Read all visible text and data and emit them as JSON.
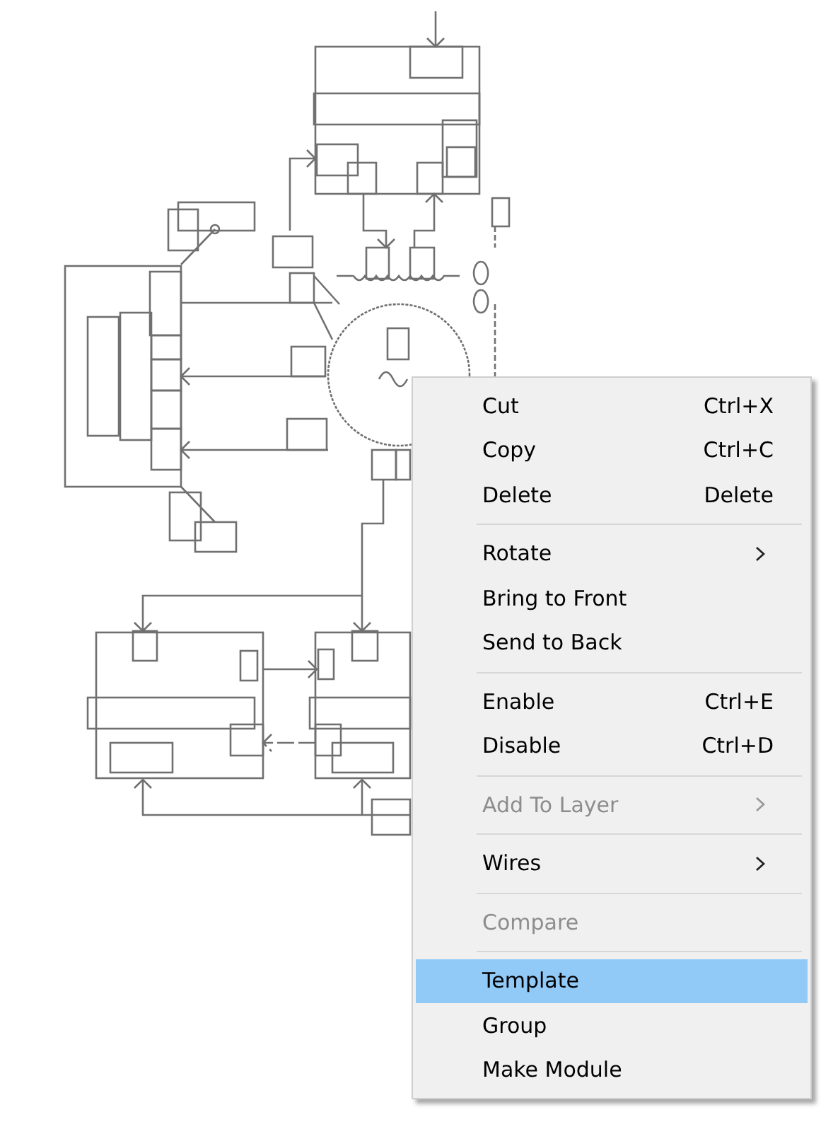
{
  "context_menu": {
    "groups": [
      {
        "items": [
          {
            "label": "Cut",
            "shortcut": "Ctrl+X",
            "submenu": false,
            "disabled": false,
            "selected": false
          },
          {
            "label": "Copy",
            "shortcut": "Ctrl+C",
            "submenu": false,
            "disabled": false,
            "selected": false
          },
          {
            "label": "Delete",
            "shortcut": "Delete",
            "submenu": false,
            "disabled": false,
            "selected": false
          }
        ]
      },
      {
        "items": [
          {
            "label": "Rotate",
            "submenu": true,
            "disabled": false,
            "selected": false
          },
          {
            "label": "Bring to Front",
            "submenu": false,
            "disabled": false,
            "selected": false
          },
          {
            "label": "Send to Back",
            "submenu": false,
            "disabled": false,
            "selected": false
          }
        ]
      },
      {
        "items": [
          {
            "label": "Enable",
            "shortcut": "Ctrl+E",
            "submenu": false,
            "disabled": false,
            "selected": false
          },
          {
            "label": "Disable",
            "shortcut": "Ctrl+D",
            "submenu": false,
            "disabled": false,
            "selected": false
          }
        ]
      },
      {
        "items": [
          {
            "label": "Add To Layer",
            "submenu": true,
            "disabled": true,
            "selected": false
          }
        ]
      },
      {
        "items": [
          {
            "label": "Wires",
            "submenu": true,
            "disabled": false,
            "selected": false
          }
        ]
      },
      {
        "items": [
          {
            "label": "Compare",
            "submenu": false,
            "disabled": true,
            "selected": false
          }
        ]
      },
      {
        "items": [
          {
            "label": "Template",
            "submenu": false,
            "disabled": false,
            "selected": true
          },
          {
            "label": "Group",
            "submenu": false,
            "disabled": false,
            "selected": false
          },
          {
            "label": "Make Module",
            "submenu": false,
            "disabled": false,
            "selected": false
          }
        ]
      }
    ]
  }
}
